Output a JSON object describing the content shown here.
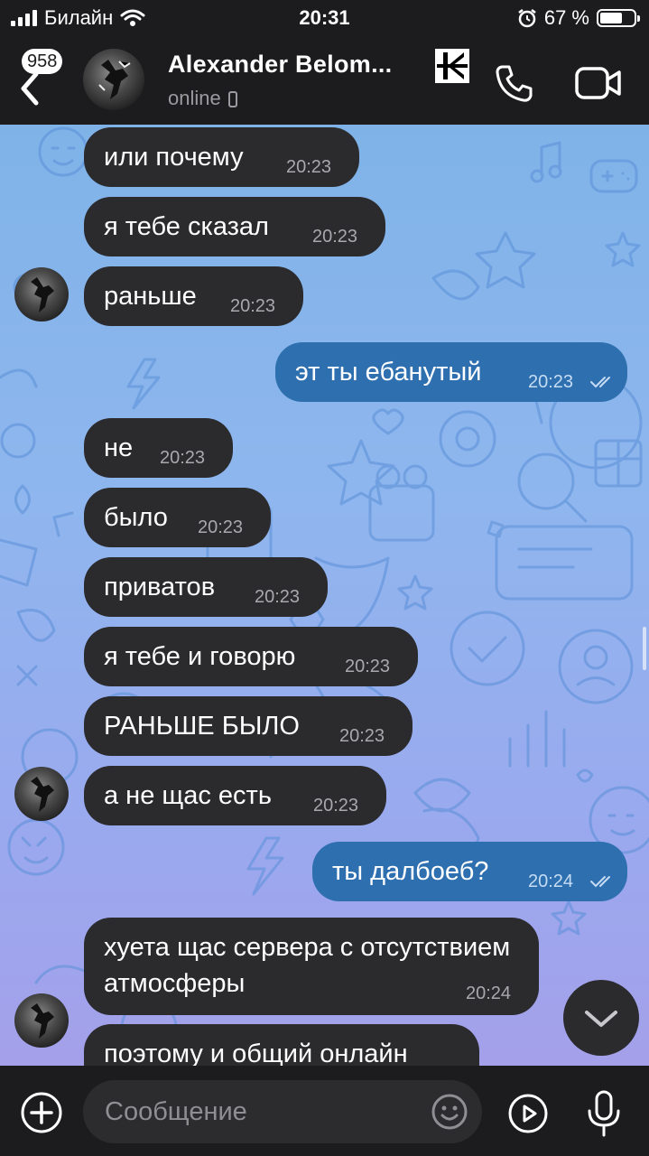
{
  "status_bar": {
    "carrier": "Билайн",
    "time": "20:31",
    "battery": "67 %",
    "battery_level": 0.67
  },
  "header": {
    "unread_count": "958",
    "contact_name": "Alexander Belom...",
    "contact_status": "online"
  },
  "messages": [
    {
      "dir": "in",
      "text": "или почему",
      "time": "20:23"
    },
    {
      "dir": "in",
      "text": "я тебе сказал",
      "time": "20:23"
    },
    {
      "dir": "in",
      "text": "раньше",
      "time": "20:23"
    },
    {
      "dir": "out",
      "text": "эт ты ебанутый",
      "time": "20:23"
    },
    {
      "dir": "in",
      "text": "не",
      "time": "20:23"
    },
    {
      "dir": "in",
      "text": "было",
      "time": "20:23"
    },
    {
      "dir": "in",
      "text": "приватов",
      "time": "20:23"
    },
    {
      "dir": "in",
      "text": "я тебе и говорю",
      "time": "20:23"
    },
    {
      "dir": "in",
      "text": "РАНЬШЕ БЫЛО",
      "time": "20:23"
    },
    {
      "dir": "in",
      "text": "а не щас есть",
      "time": "20:23"
    },
    {
      "dir": "out",
      "text": "ты далбоеб?",
      "time": "20:24"
    },
    {
      "dir": "in",
      "text": "хуета щас сервера с отсутствием атмосферы",
      "time": "20:24"
    },
    {
      "dir": "in",
      "text": "поэтому и общий онлайн",
      "time": ""
    }
  ],
  "input": {
    "placeholder": "Сообщение"
  },
  "colors": {
    "incoming_bubble": "#2b2b2e",
    "outgoing_bubble": "#2e6fb0",
    "chat_background": "#8fb6ee",
    "bar_background": "#1c1c1e"
  },
  "icons": [
    "signal-icon",
    "wifi-icon",
    "alarm-icon",
    "battery-icon",
    "back-icon",
    "phone-icon",
    "video-icon",
    "double-check-icon",
    "chevron-down-icon",
    "plus-icon",
    "emoji-icon",
    "sticker-icon",
    "mic-icon"
  ]
}
